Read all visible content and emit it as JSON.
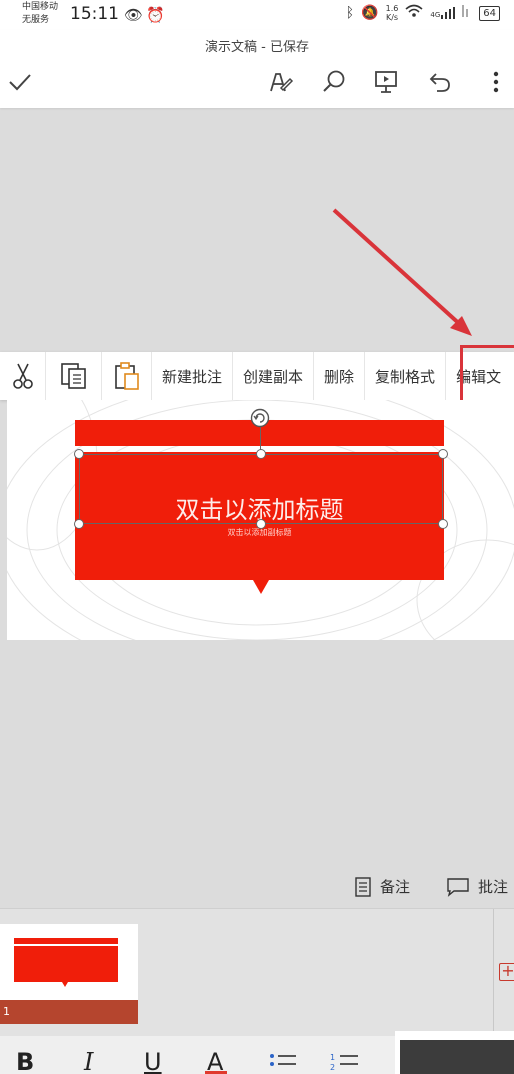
{
  "status_bar": {
    "carrier_line1": "中国移动",
    "carrier_line2": "无服务",
    "time": "15:11",
    "left_icons": [
      "eye-icon",
      "alarm-icon"
    ],
    "speed_value": "1.6",
    "speed_unit": "K/s",
    "network": "4G",
    "battery": "64"
  },
  "app": {
    "doc_title": "演示文稿 - 已保存",
    "toolbar_icons": [
      "check-icon",
      "pen-icon",
      "search-icon",
      "present-icon",
      "undo-icon",
      "more-icon"
    ]
  },
  "context_menu": {
    "icons": [
      "cut-icon",
      "copy-icon",
      "paste-icon"
    ],
    "items": [
      "新建批注",
      "创建副本",
      "删除",
      "复制格式",
      "编辑文"
    ]
  },
  "slide": {
    "title": "双击以添加标题",
    "subtitle": "双击以添加副标题"
  },
  "notes_bar": {
    "notes_label": "备注",
    "comments_label": "批注"
  },
  "thumbnails": {
    "slide_number": "1"
  },
  "format_bar": {
    "bold": "B",
    "italic": "I",
    "underline": "U",
    "font_color": "A"
  },
  "colors": {
    "shape_red": "#f01e0a",
    "highlight_red": "#d9343a",
    "thumb_bar": "#b5452e"
  }
}
